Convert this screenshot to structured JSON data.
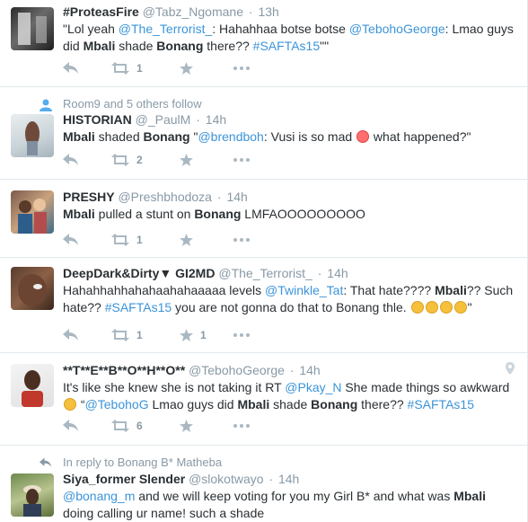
{
  "tweets": [
    {
      "name": "#ProteasFire",
      "handle": "@Tabz_Ngomane",
      "time": "13h",
      "segments": [
        {
          "t": "\"Lol yeah "
        },
        {
          "t": "@The_Terrorist_",
          "k": "link"
        },
        {
          "t": ": Hahahhaa botse botse "
        },
        {
          "t": "@TebohoGeorge",
          "k": "link"
        },
        {
          "t": ": Lmao guys did "
        },
        {
          "t": "Mbali",
          "k": "bold"
        },
        {
          "t": " shade "
        },
        {
          "t": "Bonang",
          "k": "bold"
        },
        {
          "t": " there?? "
        },
        {
          "t": "#SAFTAs15",
          "k": "link"
        },
        {
          "t": "\"\""
        }
      ],
      "retweets": "1",
      "favorites": ""
    },
    {
      "context": "Room9 and 5 others follow",
      "name": "HISTORIAN",
      "handle": "@_PaulM",
      "time": "14h",
      "segments": [
        {
          "t": "Mbali",
          "k": "bold"
        },
        {
          "t": " shaded "
        },
        {
          "t": "Bonang",
          "k": "bold"
        },
        {
          "t": " \""
        },
        {
          "t": "@brendboh",
          "k": "link"
        },
        {
          "t": ": Vusi is so mad "
        },
        {
          "k": "emoji-red"
        },
        {
          "t": " what happened?\""
        }
      ],
      "retweets": "2",
      "favorites": ""
    },
    {
      "name": "PRESHY",
      "handle": "@Preshbhodoza",
      "time": "14h",
      "segments": [
        {
          "t": "Mbali",
          "k": "bold"
        },
        {
          "t": " pulled a stunt on "
        },
        {
          "t": "Bonang",
          "k": "bold"
        },
        {
          "t": " LMFAOOOOOOOOO"
        }
      ],
      "retweets": "1",
      "favorites": ""
    },
    {
      "name": "DeepDark&Dirty▼ GI2MD",
      "handle": "@The_Terrorist_",
      "time": "14h",
      "segments": [
        {
          "t": "Hahahhahhahahaahahaaaaa levels "
        },
        {
          "t": "@Twinkle_Tat",
          "k": "link"
        },
        {
          "t": ": That hate???? "
        },
        {
          "t": "Mbali",
          "k": "bold"
        },
        {
          "t": "?? Such hate?? "
        },
        {
          "t": "#SAFTAs15",
          "k": "link"
        },
        {
          "t": " you are not gonna do that to Bonang thle. "
        },
        {
          "k": "emoji"
        },
        {
          "k": "emoji"
        },
        {
          "k": "emoji"
        },
        {
          "k": "emoji"
        },
        {
          "t": "\""
        }
      ],
      "retweets": "1",
      "favorites": "1"
    },
    {
      "name": "**T**E**B**O**H**O**",
      "handle": "@TebohoGeorge",
      "time": "14h",
      "segments": [
        {
          "t": "It's like she knew she is not taking it RT "
        },
        {
          "t": "@Pkay_N",
          "k": "link"
        },
        {
          "t": " She made things so awkward "
        },
        {
          "k": "emoji"
        },
        {
          "t": " “"
        },
        {
          "t": "@TebohoG",
          "k": "link"
        },
        {
          "t": " Lmao guys did "
        },
        {
          "t": "Mbali",
          "k": "bold"
        },
        {
          "t": " shade "
        },
        {
          "t": "Bonang",
          "k": "bold"
        },
        {
          "t": " there?? "
        },
        {
          "t": "#SAFTAs15",
          "k": "link"
        }
      ],
      "retweets": "6",
      "favorites": ""
    },
    {
      "context": "In reply to Bonang B* Matheba",
      "name": "Siya_former Slender",
      "handle": "@slokotwayo",
      "time": "14h",
      "segments": [
        {
          "t": "@bonang_m",
          "k": "link"
        },
        {
          "t": " and we will keep voting for you my Girl B* and what was "
        },
        {
          "t": "Mbali",
          "k": "bold"
        },
        {
          "t": " doing calling ur name! such a shade"
        }
      ],
      "retweets": "",
      "favorites": ""
    }
  ],
  "icons": {
    "reply": "reply-icon",
    "retweet": "retweet-icon",
    "favorite": "star-icon",
    "more": "more-dots-icon",
    "follow": "follow-person-icon",
    "replyTo": "reply-context-icon",
    "geo": "location-pin-icon"
  }
}
